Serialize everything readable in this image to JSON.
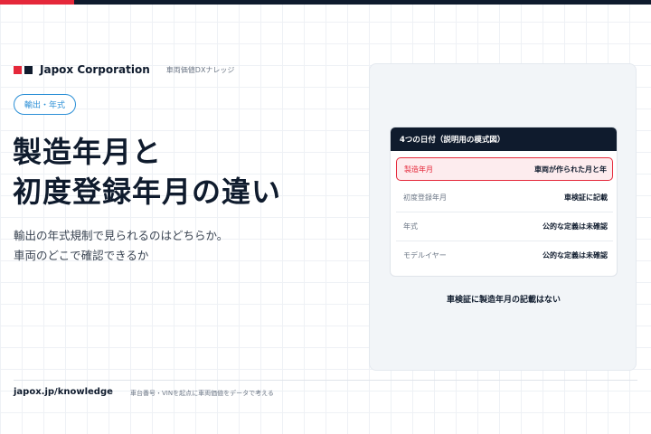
{
  "colors": {
    "accent_red": "#e5283a",
    "navy": "#0f1b2d",
    "tag_blue": "#2b8fd6",
    "panel_bg": "#f2f5f8"
  },
  "brand": {
    "name": "Japox Corporation",
    "subtitle": "車両価値DXナレッジ"
  },
  "tag": "輸出・年式",
  "headline": {
    "line1": "製造年月と",
    "line2": "初度登録年月の違い"
  },
  "subtitle": {
    "line1": "輸出の年式規制で見られるのはどちらか。",
    "line2": "車両のどこで確認できるか"
  },
  "panel": {
    "card_title": "4つの日付（説明用の模式図）",
    "rows": [
      {
        "label": "製造年月",
        "value": "車両が作られた月と年",
        "highlighted": true
      },
      {
        "label": "初度登録年月",
        "value": "車検証に記載",
        "highlighted": false
      },
      {
        "label": "年式",
        "value": "公的な定義は未確認",
        "highlighted": false
      },
      {
        "label": "モデルイヤー",
        "value": "公的な定義は未確認",
        "highlighted": false
      }
    ],
    "note": "車検証に製造年月の記載はない"
  },
  "footer": {
    "url": "japox.jp/knowledge",
    "note": "車台番号・VINを起点に車両価値をデータで考える"
  }
}
